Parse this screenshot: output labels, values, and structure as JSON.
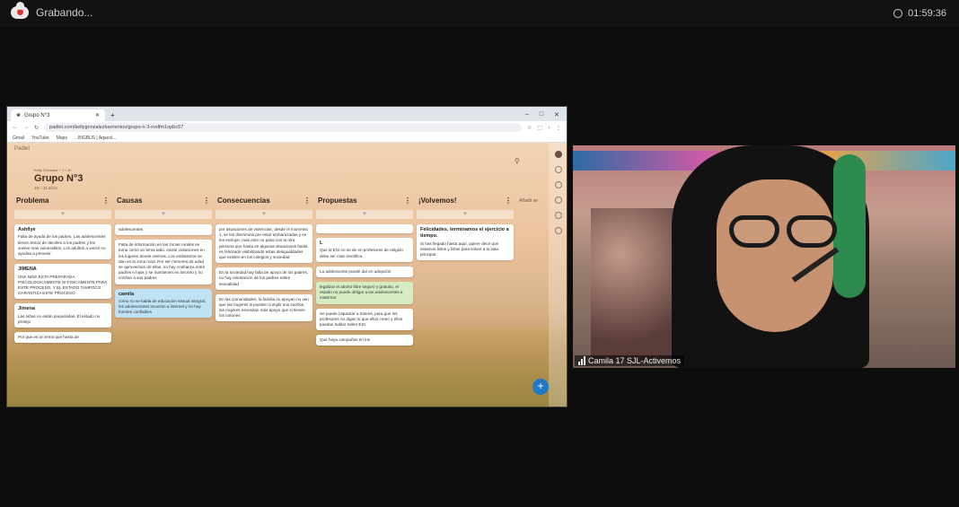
{
  "recording": {
    "label": "Grabando...",
    "timer": "01:59:36"
  },
  "browser": {
    "tab_title": "Grupo N°3",
    "url": "padlet.com/kellygonzalezbarrientos/grupo-n-3-nvdfm1opbc67",
    "bookmarks": [
      "Gmail",
      "YouTube",
      "Maps",
      "...BIGBUS | Aqacol..."
    ]
  },
  "padlet": {
    "logo": "Padlet",
    "author": "Kelly Gonzalez + 1 • 1h",
    "title": "Grupo N°3",
    "subtitle": "18 – 11 años",
    "add_column": "Añadir se",
    "columns": [
      {
        "name": "Problema",
        "cards": [
          {
            "title": "Ashllye",
            "text": "Falta de ayuda de los padres. Las adolescentes tienen temor de decirles a los padres y les vuelve mas vulnerables. Los adultos a veces no ayudan a prevenir"
          },
          {
            "title": "JIMENA",
            "text": "UNA NIÑA ESTA PREPARADA PSICOLOGICAMENTE NI FISICAMENTE PARA ESTE PROCESO, Y EL ESTADO TAMPOCO GARANTIZA ESTE PROCESO"
          },
          {
            "title": "Jimena",
            "text": "Las niñas no están preparadas. El estado no protejo"
          },
          {
            "title": "",
            "text": "Por que es un tema que hasta de"
          }
        ]
      },
      {
        "name": "Causas",
        "cards": [
          {
            "title": "",
            "text": "adolescentes"
          },
          {
            "title": "",
            "text": "Falta de información en las zonas rurales se toma como un tema tabú. existe violaciones en los lugares donde vivimos. Los embarazos se dan en la zona rural. Por ser menores de edad se aprovechan de ellas. no hay confianza entre padres e hijos y se mantienen en secreto y no confían a sus padres"
          },
          {
            "title": "camila",
            "text": "como no se habla de educacion sexual integral, los adolescentes recurren a internet y no hay fuentes confiables"
          }
        ]
      },
      {
        "name": "Consecuencias",
        "cards": [
          {
            "title": "",
            "text": "por situaciones de violencias, desde el momento 1, se les discrimina por estar embarazadas y se les excluye, mas esto no pasa con la otra persona que hasta en algunas situaciones hasta es felicitado visibilizando estas desigualdades que existen en los colegios y sociedad"
          },
          {
            "title": "",
            "text": "En la sociedad hay falta de apoyo de los padres, no hay orientación de los padres sobre sexualidad"
          },
          {
            "title": "",
            "text": "En las comunidades, la familia no apoyan no ven que las mujeres si pueden cumplir sus sueños, las mujeres necesitan más apoyo que si tienen los varones"
          }
        ]
      },
      {
        "name": "Propuestas",
        "cards": [
          {
            "title": "",
            "text": ""
          },
          {
            "title": "L",
            "text": "Que la ESI no se de en profesores de religión debe ser mas científica"
          },
          {
            "title": "",
            "text": "La adolescente puede dar en adopción"
          },
          {
            "title": "",
            "text": "legalizar el aborto libre seguro y gratuito, el estado no puede obligar a las adolescentes a maternar"
          },
          {
            "title": "",
            "text": "Se puede capacitar a tutores, para que los profesores no digan lo que ellos creen y ellos puedan hablar sobre ESI"
          },
          {
            "title": "",
            "text": "Que haya campañas en los"
          }
        ]
      },
      {
        "name": "¡Volvemos!",
        "cards": [
          {
            "title": "Felicidades, terminamos el ejercicio a tiempo.",
            "text": "Si has llegado hasta aquí, quiere decir que estamos listos y listas para volver a la sala principal."
          }
        ]
      }
    ]
  },
  "video": {
    "participant": "Camila 17 SJL-Activemos"
  }
}
